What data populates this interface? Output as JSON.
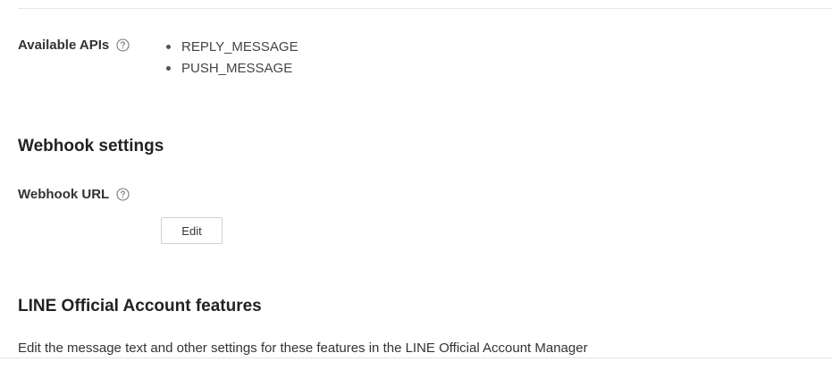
{
  "available_apis": {
    "label": "Available APIs",
    "help_icon": "help-circle-icon",
    "items": [
      "REPLY_MESSAGE",
      "PUSH_MESSAGE"
    ]
  },
  "webhook_settings": {
    "title": "Webhook settings",
    "url_label": "Webhook URL",
    "help_icon": "help-circle-icon",
    "edit_label": "Edit"
  },
  "official_account_features": {
    "title": "LINE Official Account features",
    "description": "Edit the message text and other settings for these features in the LINE Official Account Manager"
  }
}
